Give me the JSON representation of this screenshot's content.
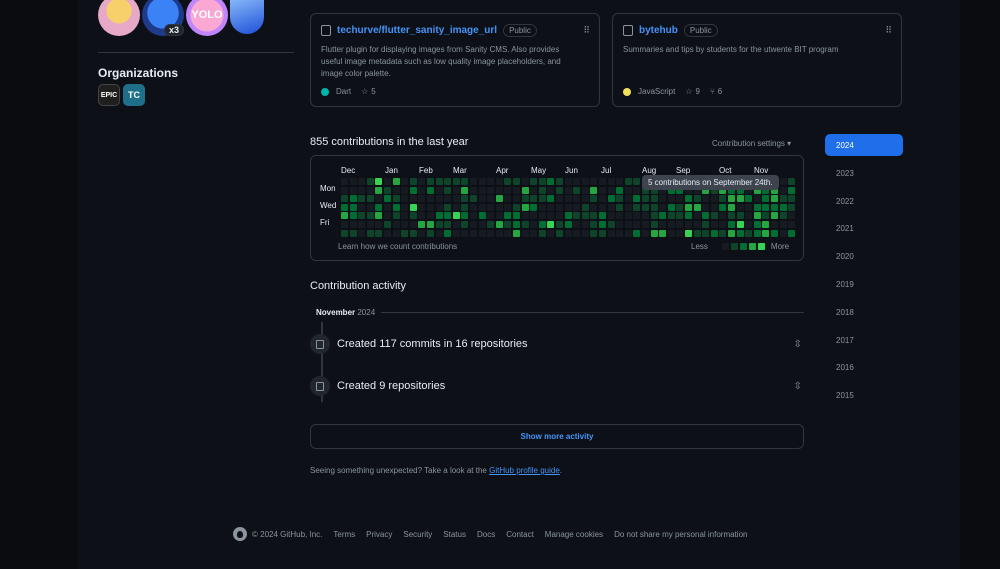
{
  "achievements": [
    {
      "icon": "grinning-face-achievement-icon",
      "label": ""
    },
    {
      "icon": "pull-shark-achievement-icon",
      "label": "x3"
    },
    {
      "icon": "yolo-achievement-icon",
      "label": "YOLO"
    },
    {
      "icon": "arctic-code-vault-achievement-icon",
      "label": ""
    }
  ],
  "organizations": {
    "title": "Organizations",
    "items": [
      {
        "icon": "epic-games-org-icon",
        "label": "EPIC"
      },
      {
        "icon": "tc-org-icon",
        "label": "TC"
      }
    ]
  },
  "pinned": [
    {
      "owner_repo": "techurve/flutter_sanity_image_url",
      "visibility": "Public",
      "description": "Flutter plugin for displaying images from Sanity CMS. Also provides useful image metadata such as low quality image placeholders, and image color palette.",
      "language": "Dart",
      "language_color": "#00b4ab",
      "stars": "5",
      "forks": ""
    },
    {
      "owner_repo": "bytehub",
      "visibility": "Public",
      "description": "Summaries and tips by students for the utwente BIT program",
      "language": "JavaScript",
      "language_color": "#f1e05a",
      "stars": "9",
      "forks": "6"
    }
  ],
  "contributions": {
    "title": "855 contributions in the last year",
    "settings_label": "Contribution settings ▾",
    "months": [
      "Dec",
      "Jan",
      "Feb",
      "Mar",
      "Apr",
      "May",
      "Jun",
      "Jul",
      "Aug",
      "Sep",
      "Oct",
      "Nov"
    ],
    "days": [
      "Mon",
      "Wed",
      "Fri"
    ],
    "learn_link": "Learn how we count contributions",
    "legend_less": "Less",
    "legend_more": "More",
    "tooltip": "5 contributions on September 24th.",
    "colors": [
      "#161b22",
      "#0e4429",
      "#006d32",
      "#26a641",
      "#39d353"
    ]
  },
  "years": [
    "2024",
    "2023",
    "2022",
    "2021",
    "2020",
    "2019",
    "2018",
    "2017",
    "2016",
    "2015"
  ],
  "active_year": "2024",
  "activity": {
    "title": "Contribution activity",
    "month": "November",
    "year": "2024",
    "items": [
      {
        "text": "Created 117 commits in 16 repositories"
      },
      {
        "text": "Created 9 repositories"
      }
    ],
    "show_more": "Show more activity",
    "unexpected_prefix": "Seeing something unexpected? Take a look at the ",
    "unexpected_link": "GitHub profile guide",
    "unexpected_suffix": "."
  },
  "footer": {
    "copyright": "© 2024 GitHub, Inc.",
    "links": [
      "Terms",
      "Privacy",
      "Security",
      "Status",
      "Docs",
      "Contact",
      "Manage cookies",
      "Do not share my personal information"
    ]
  }
}
